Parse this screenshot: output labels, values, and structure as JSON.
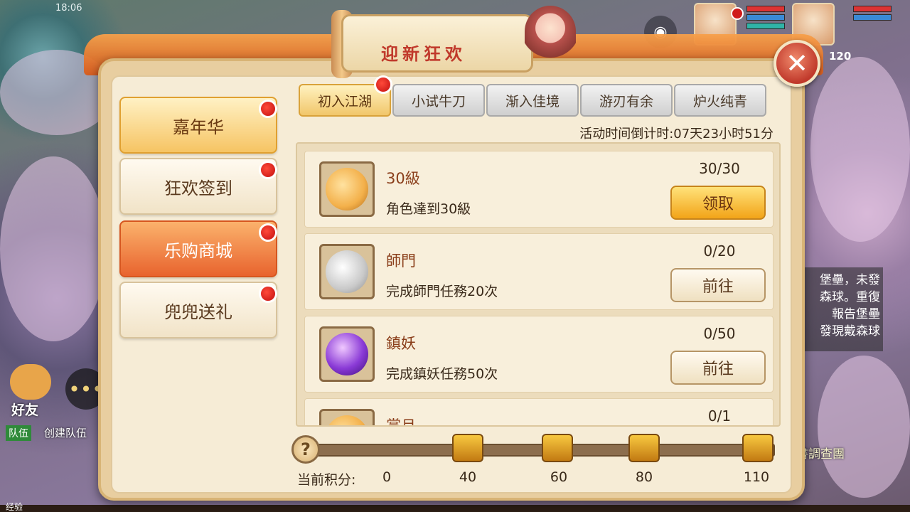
{
  "status_bar": {
    "time": "18:06"
  },
  "hud": {
    "level": "120"
  },
  "side": {
    "friends_label": "好友",
    "team_tag": "队伍",
    "team_label": "创建队伍",
    "notice_lines": [
      "堡壘，未發",
      "森球。重復",
      "報告堡壘",
      "發現戴森球"
    ],
    "bottom_notice": "書調查團",
    "exp_label": "经验"
  },
  "panel": {
    "title": "迎新狂欢",
    "close_icon": "close-icon"
  },
  "nav": [
    {
      "label": "嘉年华",
      "style": "gold"
    },
    {
      "label": "狂欢签到",
      "style": "normal"
    },
    {
      "label": "乐购商城",
      "style": "red"
    },
    {
      "label": "兜兜送礼",
      "style": "normal"
    }
  ],
  "tabs": [
    "初入江湖",
    "小试牛刀",
    "渐入佳境",
    "游刃有余",
    "炉火纯青"
  ],
  "active_tab": "初入江湖",
  "countdown": "活动时间倒计时:07天23小时51分",
  "tasks": [
    {
      "title": "30級",
      "desc": "角色達到30級",
      "progress": "30/30",
      "button": "领取",
      "icon": "gift-bag-icon",
      "icon_color": "#f3b04a"
    },
    {
      "title": "師門",
      "desc": "完成師門任務20次",
      "progress": "0/20",
      "button": "前往",
      "icon": "silver-bag-icon",
      "icon_color": "#c9c9c9"
    },
    {
      "title": "鎮妖",
      "desc": "完成鎮妖任務50次",
      "progress": "0/50",
      "button": "前往",
      "icon": "exp-orb-icon",
      "icon_color": "#8a3ad6"
    },
    {
      "title": "賞月",
      "desc": "",
      "progress": "0/1",
      "button": "",
      "icon": "gift-bag-icon",
      "icon_color": "#f3b04a"
    }
  ],
  "score": {
    "label": "当前积分:",
    "current": "0",
    "milestones": [
      "40",
      "60",
      "80",
      "110"
    ],
    "progress_fraction": 0
  }
}
